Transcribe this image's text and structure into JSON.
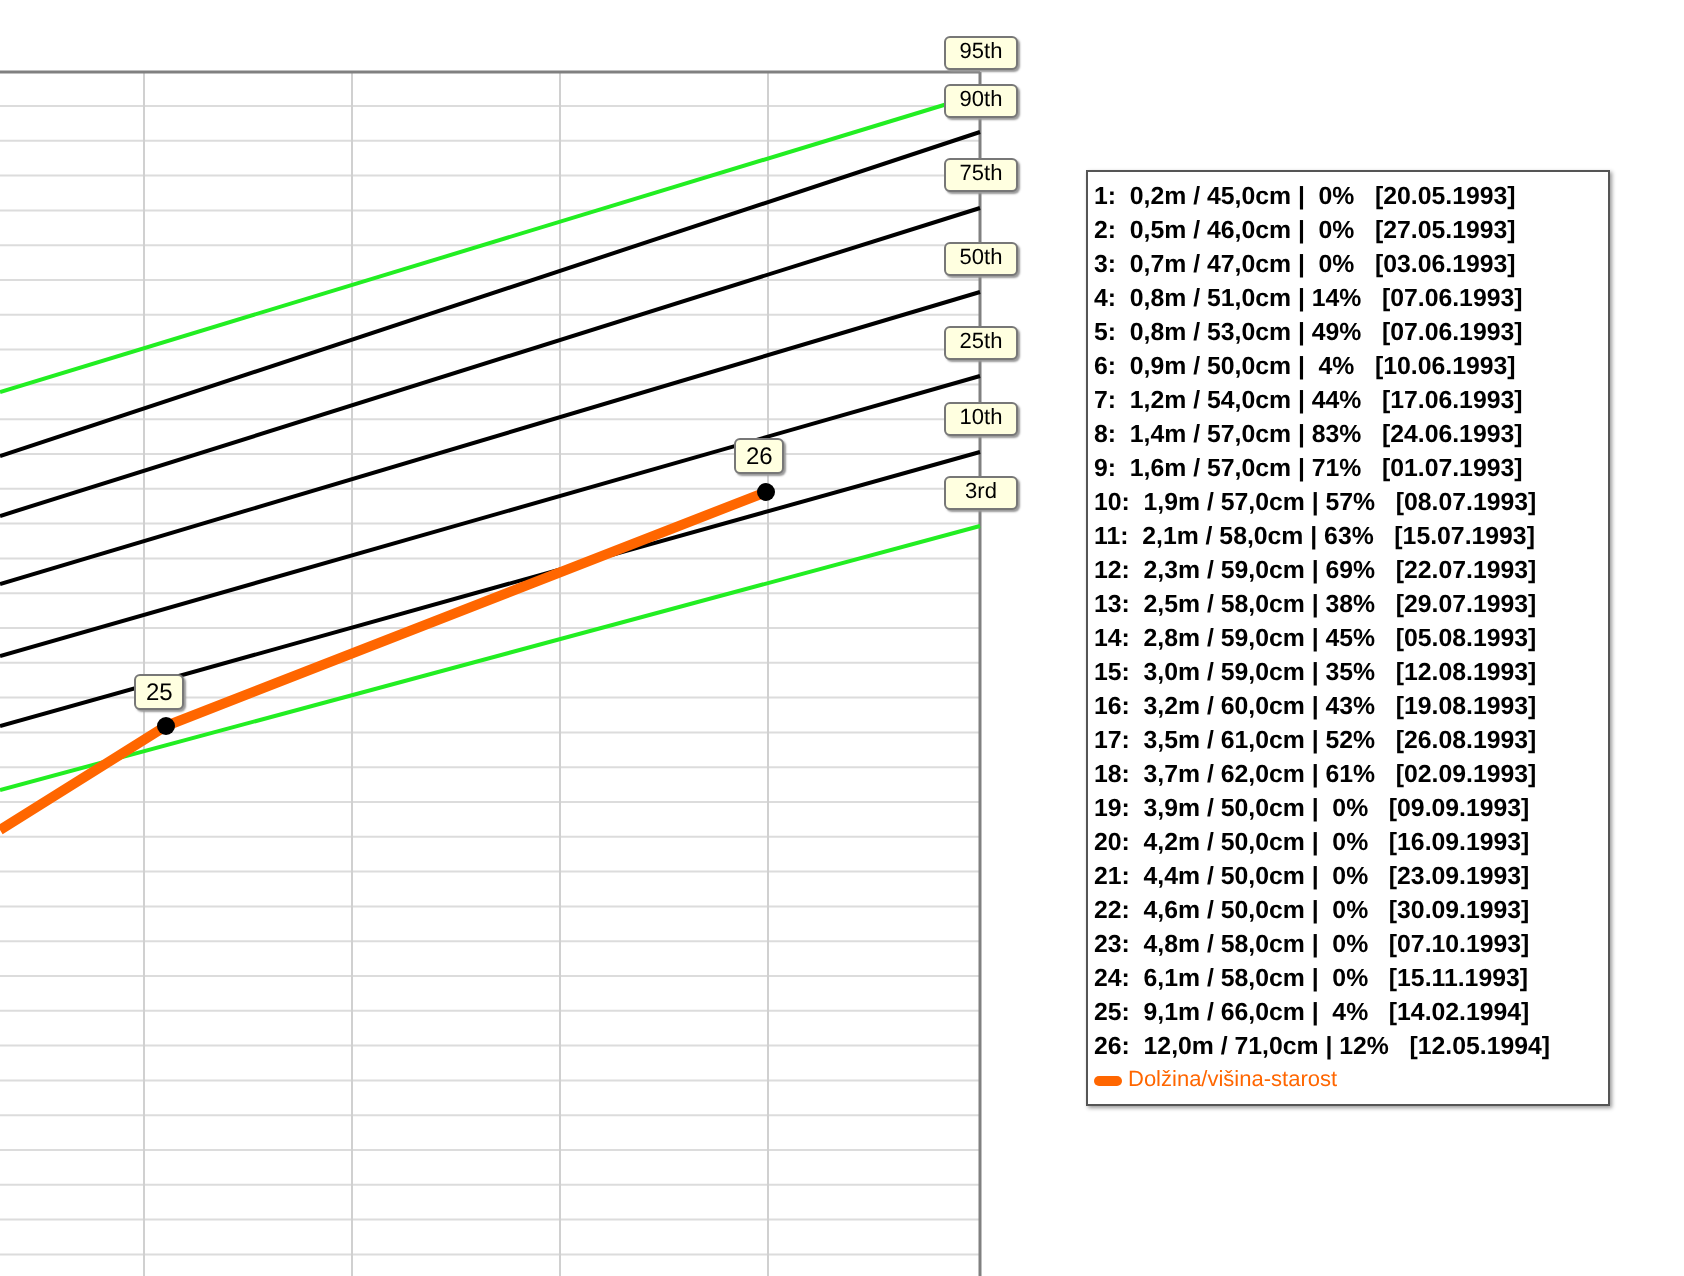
{
  "chart": {
    "percentile_labels": [
      "95th",
      "90th",
      "75th",
      "50th",
      "25th",
      "10th",
      "3rd"
    ],
    "point_labels": [
      "25",
      "26"
    ]
  },
  "legend": {
    "entries": [
      "1:  0,2m / 45,0cm |  0%   [20.05.1993]",
      "2:  0,5m / 46,0cm |  0%   [27.05.1993]",
      "3:  0,7m / 47,0cm |  0%   [03.06.1993]",
      "4:  0,8m / 51,0cm | 14%   [07.06.1993]",
      "5:  0,8m / 53,0cm | 49%   [07.06.1993]",
      "6:  0,9m / 50,0cm |  4%   [10.06.1993]",
      "7:  1,2m / 54,0cm | 44%   [17.06.1993]",
      "8:  1,4m / 57,0cm | 83%   [24.06.1993]",
      "9:  1,6m / 57,0cm | 71%   [01.07.1993]",
      "10:  1,9m / 57,0cm | 57%   [08.07.1993]",
      "11:  2,1m / 58,0cm | 63%   [15.07.1993]",
      "12:  2,3m / 59,0cm | 69%   [22.07.1993]",
      "13:  2,5m / 58,0cm | 38%   [29.07.1993]",
      "14:  2,8m / 59,0cm | 45%   [05.08.1993]",
      "15:  3,0m / 59,0cm | 35%   [12.08.1993]",
      "16:  3,2m / 60,0cm | 43%   [19.08.1993]",
      "17:  3,5m / 61,0cm | 52%   [26.08.1993]",
      "18:  3,7m / 62,0cm | 61%   [02.09.1993]",
      "19:  3,9m / 50,0cm |  0%   [09.09.1993]",
      "20:  4,2m / 50,0cm |  0%   [16.09.1993]",
      "21:  4,4m / 50,0cm |  0%   [23.09.1993]",
      "22:  4,6m / 50,0cm |  0%   [30.09.1993]",
      "23:  4,8m / 58,0cm |  0%   [07.10.1993]",
      "24:  6,1m / 58,0cm |  0%   [15.11.1993]",
      "25:  9,1m / 66,0cm |  4%   [14.02.1994]",
      "26:  12,0m / 71,0cm | 12%   [12.05.1994]"
    ],
    "series": [
      {
        "name": "Dolžina/višina-starost",
        "color": "#ff6600"
      }
    ]
  }
}
